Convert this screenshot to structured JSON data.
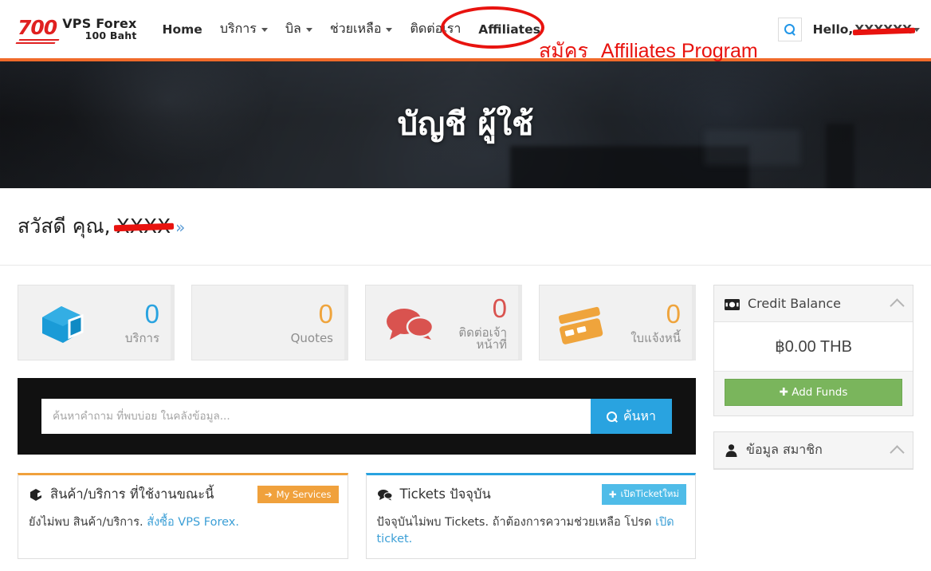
{
  "header": {
    "logo": {
      "mark": "700",
      "line1": "VPS Forex",
      "line2": "100 Baht"
    },
    "nav": [
      {
        "label": "Home",
        "caret": false,
        "thai": false
      },
      {
        "label": "บริการ",
        "caret": true,
        "thai": true
      },
      {
        "label": "บิล",
        "caret": true,
        "thai": true
      },
      {
        "label": "ช่วยเหลือ",
        "caret": true,
        "thai": true
      },
      {
        "label": "ติดต่อเรา",
        "caret": false,
        "thai": true
      },
      {
        "label": "Affiliates",
        "caret": false,
        "thai": false
      }
    ],
    "search_icon": "search-icon",
    "hello_label": "Hello,",
    "hello_name": "XXXXXX"
  },
  "annotation": {
    "text_thai": "สมัคร",
    "text_en": "Affiliates Program",
    "color": "#e8130f",
    "circled_target": "Affiliates"
  },
  "hero": {
    "title": "บัญชี ผู้ใช้"
  },
  "greeting": {
    "prefix": "สวัสดี คุณ,",
    "name": "XXXX",
    "chevron": "»"
  },
  "stats": [
    {
      "icon": "box-icon",
      "value": "0",
      "label": "บริการ",
      "color": "#29a3e0"
    },
    {
      "icon": "none",
      "value": "0",
      "label": "Quotes",
      "color": "#efa43c"
    },
    {
      "icon": "chat-bubbles-icon",
      "value": "0",
      "label": "ติดต่อเจ้าหน้าที่",
      "color": "#d9534f"
    },
    {
      "icon": "credit-card-icon",
      "value": "0",
      "label": "ใบแจ้งหนี้",
      "color": "#efa43c"
    }
  ],
  "search": {
    "placeholder": "ค้นหาคำถาม ที่พบบ่อย ในคลังข้อมูล...",
    "button_label": "ค้นหา",
    "button_icon": "search-icon"
  },
  "panels": [
    {
      "icon": "box-icon",
      "title": "สินค้า/บริการ ที่ใช้งานขณะนี้",
      "button_label": "My Services",
      "button_icon": "arrow-right-icon",
      "button_color": "#f0a13c",
      "body_text": "ยังไม่พบ สินค้า/บริการ.",
      "body_link": "สั่งซื้อ VPS Forex.",
      "accent": "#f0a13c"
    },
    {
      "icon": "chat-bubbles-icon",
      "title": "Tickets ปัจจุบัน",
      "button_label": "เปิดTicketใหม่",
      "button_icon": "plus-icon",
      "button_color": "#4fbce8",
      "body_text": "ปัจจุบันไม่พบ Tickets. ถ้าต้องการความช่วยเหลือ โปรด",
      "body_link": "เปิด ticket.",
      "accent": "#29a3e0"
    }
  ],
  "sidebar": {
    "credit": {
      "icon": "money-icon",
      "title": "Credit Balance",
      "collapse_icon": "chevron-up-icon",
      "amount": "฿0.00 THB",
      "button_label": "Add Funds",
      "button_icon": "plus-icon",
      "button_color": "#7ab55c"
    },
    "member": {
      "icon": "person-icon",
      "title": "ข้อมูล สมาชิก",
      "collapse_icon": "chevron-up-icon"
    }
  }
}
